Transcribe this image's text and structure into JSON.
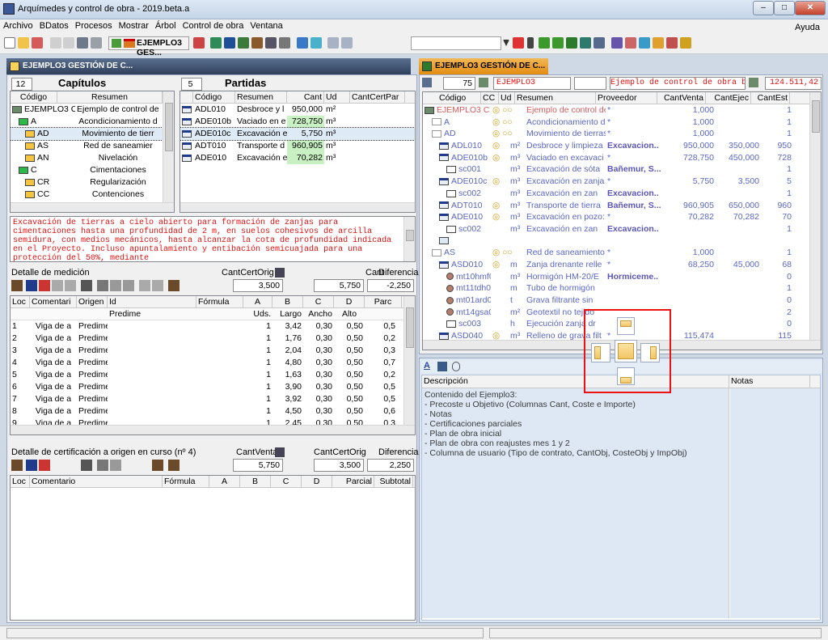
{
  "window": {
    "title": "Arquímedes y control de obra - 2019.beta.a"
  },
  "menu": [
    "Archivo",
    "BDatos",
    "Procesos",
    "Mostrar",
    "Árbol",
    "Control de obra",
    "Ventana"
  ],
  "menu_help": "Ayuda",
  "toolbar": {
    "project_combo": "EJEMPLO3 GES..."
  },
  "left_pane_title": "EJEMPLO3 GESTIÓN DE C...",
  "right_pane_title": "EJEMPLO3 GESTIÓN DE C...",
  "capitulos": {
    "count": "12",
    "title": "Capítulos",
    "headers": [
      "Código",
      "Resumen"
    ],
    "rows": [
      {
        "code": "EJEMPLO3 C",
        "desc": "Ejemplo de control de"
      },
      {
        "code": "A",
        "desc": "Acondicionamiento d"
      },
      {
        "code": "AD",
        "desc": "Movimiento de tierr"
      },
      {
        "code": "AS",
        "desc": "Red de saneamier"
      },
      {
        "code": "AN",
        "desc": "Nivelación"
      },
      {
        "code": "C",
        "desc": "Cimentaciones"
      },
      {
        "code": "CR",
        "desc": "Regularización"
      },
      {
        "code": "CC",
        "desc": "Contenciones"
      }
    ]
  },
  "partidas": {
    "count": "5",
    "title": "Partidas",
    "headers": [
      "Código",
      "Resumen",
      "Cant",
      "Ud",
      "CantCertPar"
    ],
    "rows": [
      {
        "code": "ADL010",
        "desc": "Desbroce y l",
        "cant": "950,000",
        "ud": "m²"
      },
      {
        "code": "ADE010b",
        "desc": "Vaciado en e",
        "cant": "728,750",
        "ud": "m³"
      },
      {
        "code": "ADE010c",
        "desc": "Excavación e",
        "cant": "5,750",
        "ud": "m³"
      },
      {
        "code": "ADT010",
        "desc": "Transporte d",
        "cant": "960,905",
        "ud": "m³"
      },
      {
        "code": "ADE010",
        "desc": "Excavación e",
        "cant": "70,282",
        "ud": "m³"
      }
    ]
  },
  "description": "Excavación de tierras a cielo abierto para formación de zanjas para cimentaciones hasta una profundidad de 2 m, en suelos cohesivos de arcilla semidura, con medios mecánicos, hasta alcanzar la cota de profundidad indicada en el Proyecto. Incluso apuntalamiento y entibación semicuajada para una protección del 50%, mediante",
  "medicion": {
    "title": "Detalle de medición",
    "labels": {
      "cantcertorig": "CantCertOrig",
      "cant": "Cant",
      "diferencia": "Diferencia"
    },
    "values": {
      "cantcertorig": "3,500",
      "cant": "5,750",
      "diferencia": "-2,250"
    },
    "headers": [
      "Loc",
      "Comentari",
      "Origen",
      "Id",
      "Fórmula",
      "A",
      "B",
      "C",
      "D",
      "Parc"
    ],
    "sub_headers": {
      "predime": "Predime",
      "uds": "Uds.",
      "largo": "Largo",
      "ancho": "Ancho",
      "alto": "Alto"
    },
    "rows": [
      {
        "loc": "1",
        "com": "Viga de a",
        "orig": "Predime",
        "uds": "1",
        "b": "3,42",
        "c": "0,30",
        "d": "0,50",
        "p": "0,5"
      },
      {
        "loc": "2",
        "com": "Viga de a",
        "orig": "Predime",
        "uds": "1",
        "b": "1,76",
        "c": "0,30",
        "d": "0,50",
        "p": "0,2"
      },
      {
        "loc": "3",
        "com": "Viga de a",
        "orig": "Predime",
        "uds": "1",
        "b": "2,04",
        "c": "0,30",
        "d": "0,50",
        "p": "0,3"
      },
      {
        "loc": "4",
        "com": "Viga de a",
        "orig": "Predime",
        "uds": "1",
        "b": "4,80",
        "c": "0,30",
        "d": "0,50",
        "p": "0,7"
      },
      {
        "loc": "5",
        "com": "Viga de a",
        "orig": "Predime",
        "uds": "1",
        "b": "1,63",
        "c": "0,30",
        "d": "0,50",
        "p": "0,2"
      },
      {
        "loc": "6",
        "com": "Viga de a",
        "orig": "Predime",
        "uds": "1",
        "b": "3,90",
        "c": "0,30",
        "d": "0,50",
        "p": "0,5"
      },
      {
        "loc": "7",
        "com": "Viga de a",
        "orig": "Predime",
        "uds": "1",
        "b": "3,92",
        "c": "0,30",
        "d": "0,50",
        "p": "0,5"
      },
      {
        "loc": "8",
        "com": "Viga de a",
        "orig": "Predime",
        "uds": "1",
        "b": "4,50",
        "c": "0,30",
        "d": "0,50",
        "p": "0,6"
      },
      {
        "loc": "9",
        "com": "Viga de a",
        "orig": "Predime",
        "uds": "1",
        "b": "2,45",
        "c": "0,30",
        "d": "0,50",
        "p": "0,3"
      }
    ]
  },
  "certificacion": {
    "title": "Detalle de certificación a origen en curso (nº 4)",
    "labels": {
      "cantventa": "CantVenta",
      "cantcertorig": "CantCertOrig",
      "diferencia": "Diferencia"
    },
    "values": {
      "cantventa": "5,750",
      "cantcertorig": "3,500",
      "diferencia": "2,250"
    },
    "headers": [
      "Loc",
      "Comentario",
      "Fórmula",
      "A",
      "B",
      "C",
      "D",
      "Parcial",
      "Subtotal"
    ]
  },
  "tree": {
    "top": {
      "count": "75",
      "code": "EJEMPLO3",
      "desc": "Ejemplo de control de obra basado",
      "total": "124.511,42"
    },
    "headers": [
      "Código",
      "CC",
      "Ud",
      "Resumen",
      "Proveedor",
      "CantVenta",
      "CantEjec",
      "CantEst"
    ],
    "rows": [
      {
        "indent": 0,
        "code": "EJEMPLO3 C",
        "cc": "",
        "ud": "",
        "desc": "Ejemplo de control de ol",
        "prov": "*",
        "venta": "1,000",
        "ejec": "",
        "est": "1",
        "kind": "root"
      },
      {
        "indent": 1,
        "code": "A",
        "cc": "",
        "ud": "",
        "desc": "Acondicionamiento del",
        "prov": "*",
        "venta": "1,000",
        "ejec": "",
        "est": "1",
        "kind": "chap"
      },
      {
        "indent": 1,
        "code": "AD",
        "cc": "",
        "ud": "",
        "desc": "Movimiento de tierras",
        "prov": "*",
        "venta": "1,000",
        "ejec": "",
        "est": "1",
        "kind": "chap"
      },
      {
        "indent": 2,
        "code": "ADL010",
        "cc": "",
        "ud": "m²",
        "desc": "Desbroce y limpieza",
        "prov": "Excavacion..",
        "venta": "950,000",
        "ejec": "350,000",
        "est": "950",
        "kind": "part"
      },
      {
        "indent": 2,
        "code": "ADE010b",
        "cc": "",
        "ud": "m³",
        "desc": "Vaciado en excavaci",
        "prov": "*",
        "venta": "728,750",
        "ejec": "450,000",
        "est": "728",
        "kind": "part"
      },
      {
        "indent": 3,
        "code": "sc001",
        "cc": "",
        "ud": "m³",
        "desc": "Excavación de sóta",
        "prov": "Bañemur, S...",
        "venta": "",
        "ejec": "",
        "est": "1",
        "kind": "sub"
      },
      {
        "indent": 2,
        "code": "ADE010c",
        "cc": "",
        "ud": "m³",
        "desc": "Excavación en zanja",
        "prov": "*",
        "venta": "5,750",
        "ejec": "3,500",
        "est": "5",
        "kind": "part"
      },
      {
        "indent": 3,
        "code": "sc002",
        "cc": "",
        "ud": "m³",
        "desc": "Excavación en zan",
        "prov": "Excavacion..",
        "venta": "",
        "ejec": "",
        "est": "1",
        "kind": "sub"
      },
      {
        "indent": 2,
        "code": "ADT010",
        "cc": "",
        "ud": "m³",
        "desc": "Transporte de tierra",
        "prov": "Bañemur, S...",
        "venta": "960,905",
        "ejec": "650,000",
        "est": "960",
        "kind": "part"
      },
      {
        "indent": 2,
        "code": "ADE010",
        "cc": "",
        "ud": "m³",
        "desc": "Excavación en pozo:",
        "prov": "*",
        "venta": "70,282",
        "ejec": "70,282",
        "est": "70",
        "kind": "part"
      },
      {
        "indent": 3,
        "code": "sc002",
        "cc": "",
        "ud": "m³",
        "desc": "Excavación en zan",
        "prov": "Excavacion..",
        "venta": "",
        "ejec": "",
        "est": "1",
        "kind": "sub"
      },
      {
        "indent": 2,
        "code": "",
        "cc": "",
        "ud": "",
        "desc": "",
        "prov": "",
        "venta": "",
        "ejec": "",
        "est": "",
        "kind": "blank"
      },
      {
        "indent": 1,
        "code": "AS",
        "cc": "",
        "ud": "",
        "desc": "Red de saneamiento",
        "prov": "*",
        "venta": "1,000",
        "ejec": "",
        "est": "1",
        "kind": "chap"
      },
      {
        "indent": 2,
        "code": "ASD010",
        "cc": "",
        "ud": "m",
        "desc": "Zanja drenante relle",
        "prov": "*",
        "venta": "68,250",
        "ejec": "45,000",
        "est": "68",
        "kind": "part"
      },
      {
        "indent": 3,
        "code": "mt10hmf010",
        "cc": "",
        "ud": "m³",
        "desc": "Hormigón HM-20/E",
        "prov": "Hormiceme..",
        "venta": "",
        "ejec": "",
        "est": "0",
        "kind": "mat"
      },
      {
        "indent": 3,
        "code": "mt11tdh010a",
        "cc": "",
        "ud": "m",
        "desc": "Tubo de hormigón",
        "prov": "",
        "venta": "",
        "ejec": "",
        "est": "1",
        "kind": "mat"
      },
      {
        "indent": 3,
        "code": "mt01ard030l",
        "cc": "",
        "ud": "t",
        "desc": "Grava filtrante sin",
        "prov": "",
        "venta": "",
        "ejec": "",
        "est": "0",
        "kind": "mat"
      },
      {
        "indent": 3,
        "code": "mt14gsa020",
        "cc": "",
        "ud": "m²",
        "desc": "Geotextil no tejido",
        "prov": "",
        "venta": "",
        "ejec": "",
        "est": "2",
        "kind": "mat"
      },
      {
        "indent": 3,
        "code": "sc003",
        "cc": "",
        "ud": "h",
        "desc": "Ejecución zanja dr",
        "prov": "",
        "venta": "",
        "ejec": "",
        "est": "0",
        "kind": "sub"
      },
      {
        "indent": 2,
        "code": "ASD040",
        "cc": "",
        "ud": "m³",
        "desc": "Relleno de grava filt",
        "prov": "*",
        "venta": "115,474",
        "ejec": "",
        "est": "115",
        "kind": "part"
      }
    ]
  },
  "notes_panel": {
    "desc_header": "Descripción",
    "notes_header": "Notas",
    "lines": [
      "Contenido del Ejemplo3:",
      "- Precoste u Objetivo (Columnas Cant, Coste e Importe)",
      "- Notas",
      "- Certificaciones parciales",
      "- Plan de obra inicial",
      "- Plan de obra con reajustes mes 1 y 2",
      "- Columna de usuario (Tipo de contrato, CantObj, CosteObj y ImpObj)"
    ]
  }
}
